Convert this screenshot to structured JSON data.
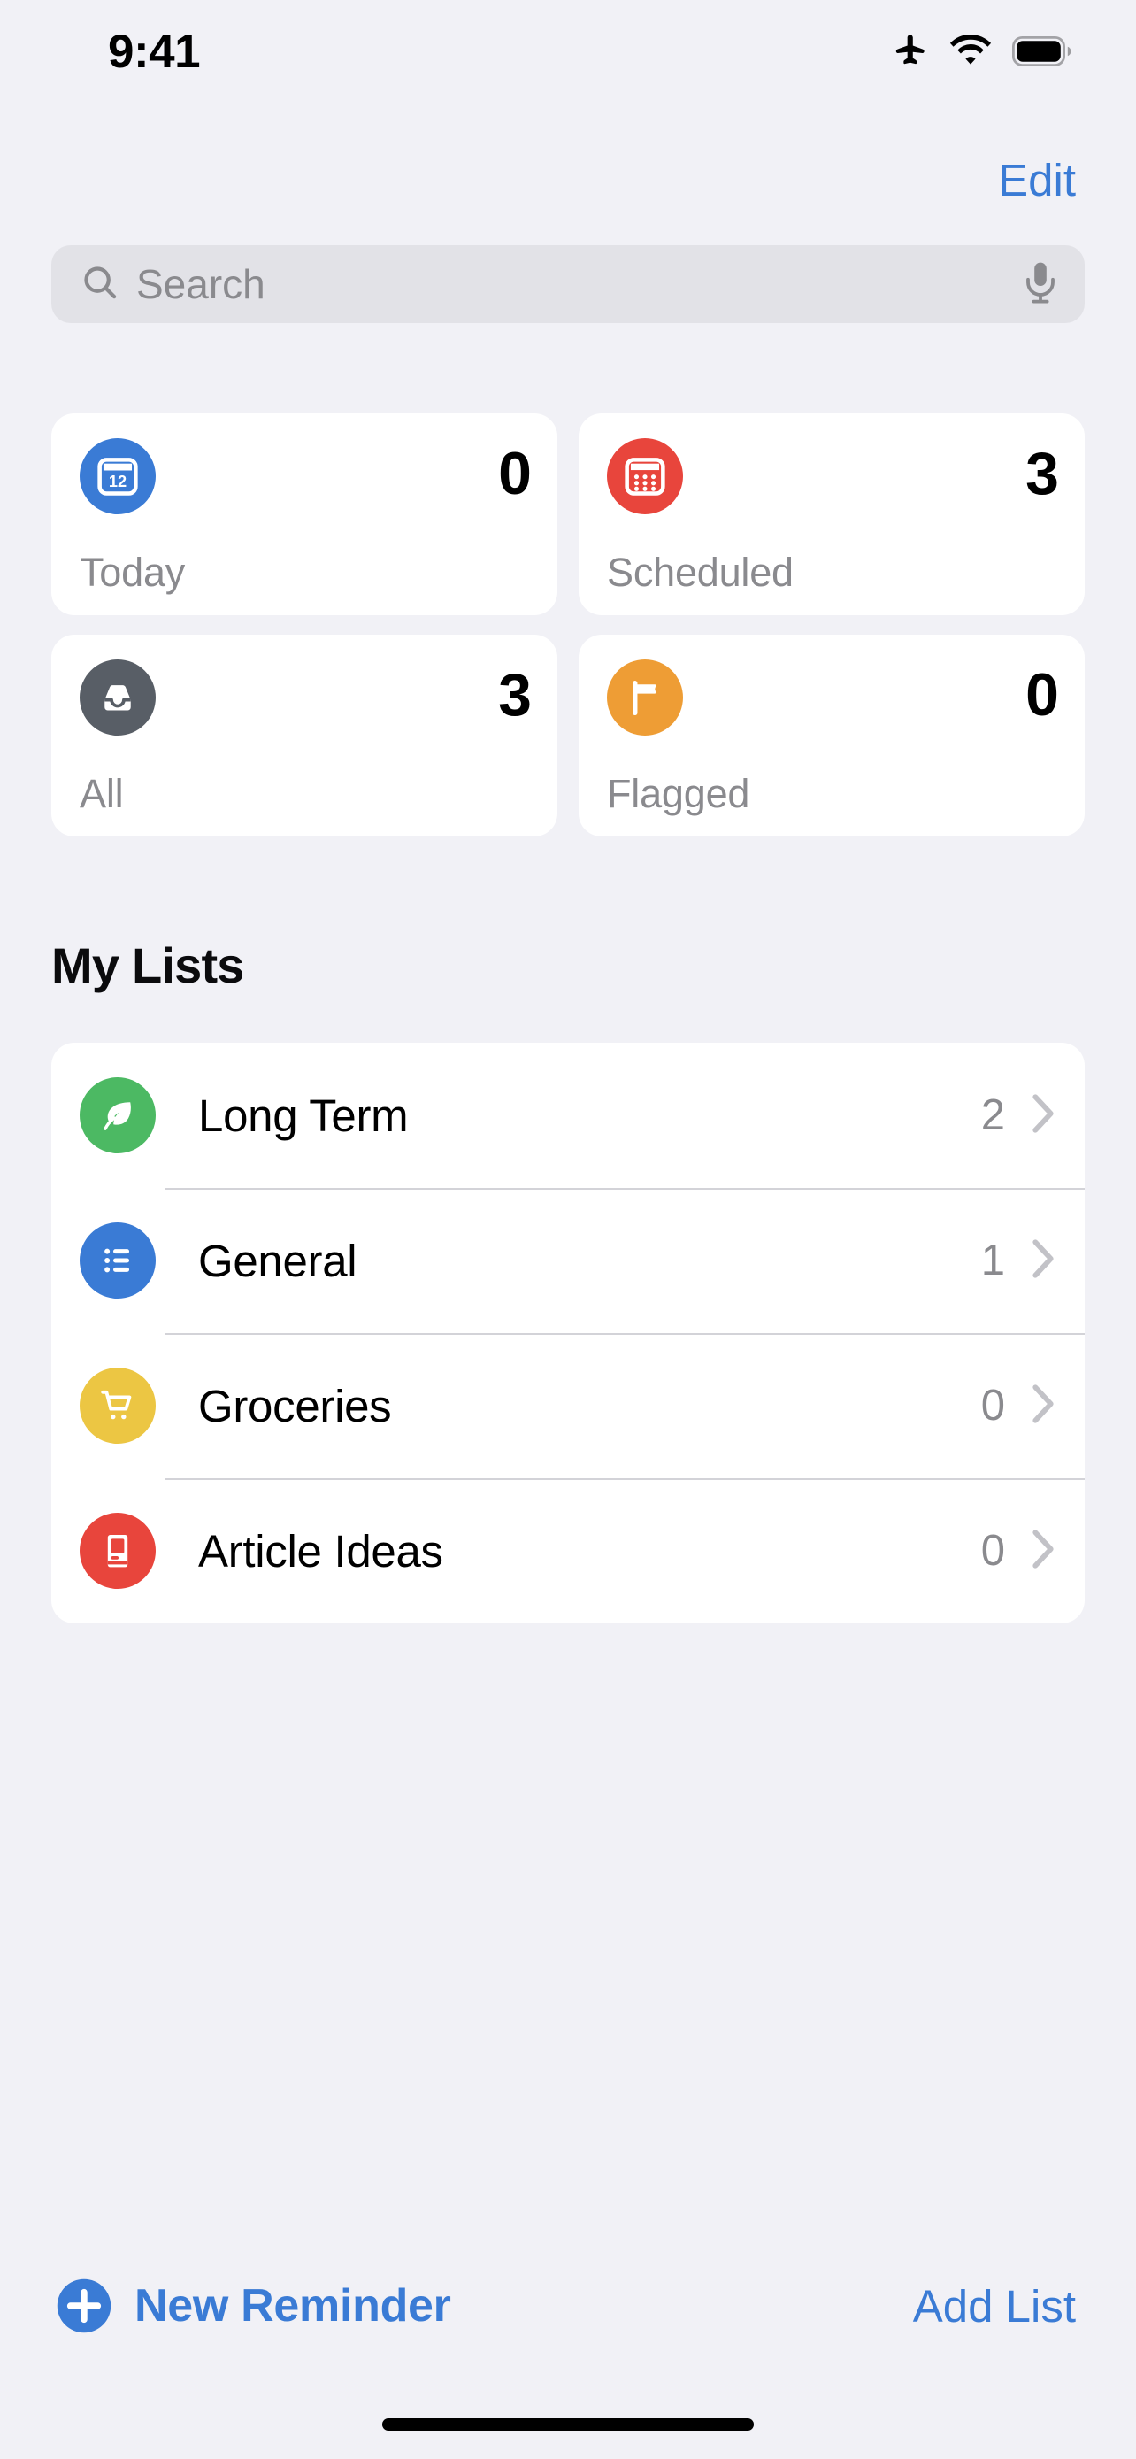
{
  "status_bar": {
    "time": "9:41",
    "icons": [
      "airplane-mode-icon",
      "wifi-icon",
      "battery-full-icon"
    ]
  },
  "navbar": {
    "edit_label": "Edit"
  },
  "search": {
    "placeholder": "Search",
    "value": "",
    "leading_icon": "search-icon",
    "trailing_icon": "microphone-icon"
  },
  "smart_lists": [
    {
      "key": "today",
      "label": "Today",
      "count": "0",
      "icon": "calendar-day-icon",
      "color": "#3a7bd5"
    },
    {
      "key": "scheduled",
      "label": "Scheduled",
      "count": "3",
      "icon": "calendar-grid-icon",
      "color": "#e8453c"
    },
    {
      "key": "all",
      "label": "All",
      "count": "3",
      "icon": "inbox-tray-icon",
      "color": "#585e66"
    },
    {
      "key": "flagged",
      "label": "Flagged",
      "count": "0",
      "icon": "flag-icon",
      "color": "#ee9d35"
    }
  ],
  "my_lists": {
    "title": "My Lists",
    "rows": [
      {
        "key": "long-term",
        "label": "Long Term",
        "count": "2",
        "icon": "leaf-icon",
        "color": "#4cb963"
      },
      {
        "key": "general",
        "label": "General",
        "count": "1",
        "icon": "bulleted-list-icon",
        "color": "#3a7bd5"
      },
      {
        "key": "groceries",
        "label": "Groceries",
        "count": "0",
        "icon": "shopping-cart-icon",
        "color": "#ecc643"
      },
      {
        "key": "article-ideas",
        "label": "Article Ideas",
        "count": "0",
        "icon": "book-icon",
        "color": "#e8453c"
      }
    ]
  },
  "toolbar": {
    "new_reminder_label": "New Reminder",
    "new_reminder_icon": "plus-circle-icon",
    "add_list_label": "Add List"
  },
  "colors": {
    "background": "#f1f1f6",
    "card": "#ffffff",
    "accent_blue": "#3a7bd5",
    "secondary_text": "#8a8a8e",
    "separator": "#d3d3d8",
    "search_field": "#e2e2e7"
  }
}
